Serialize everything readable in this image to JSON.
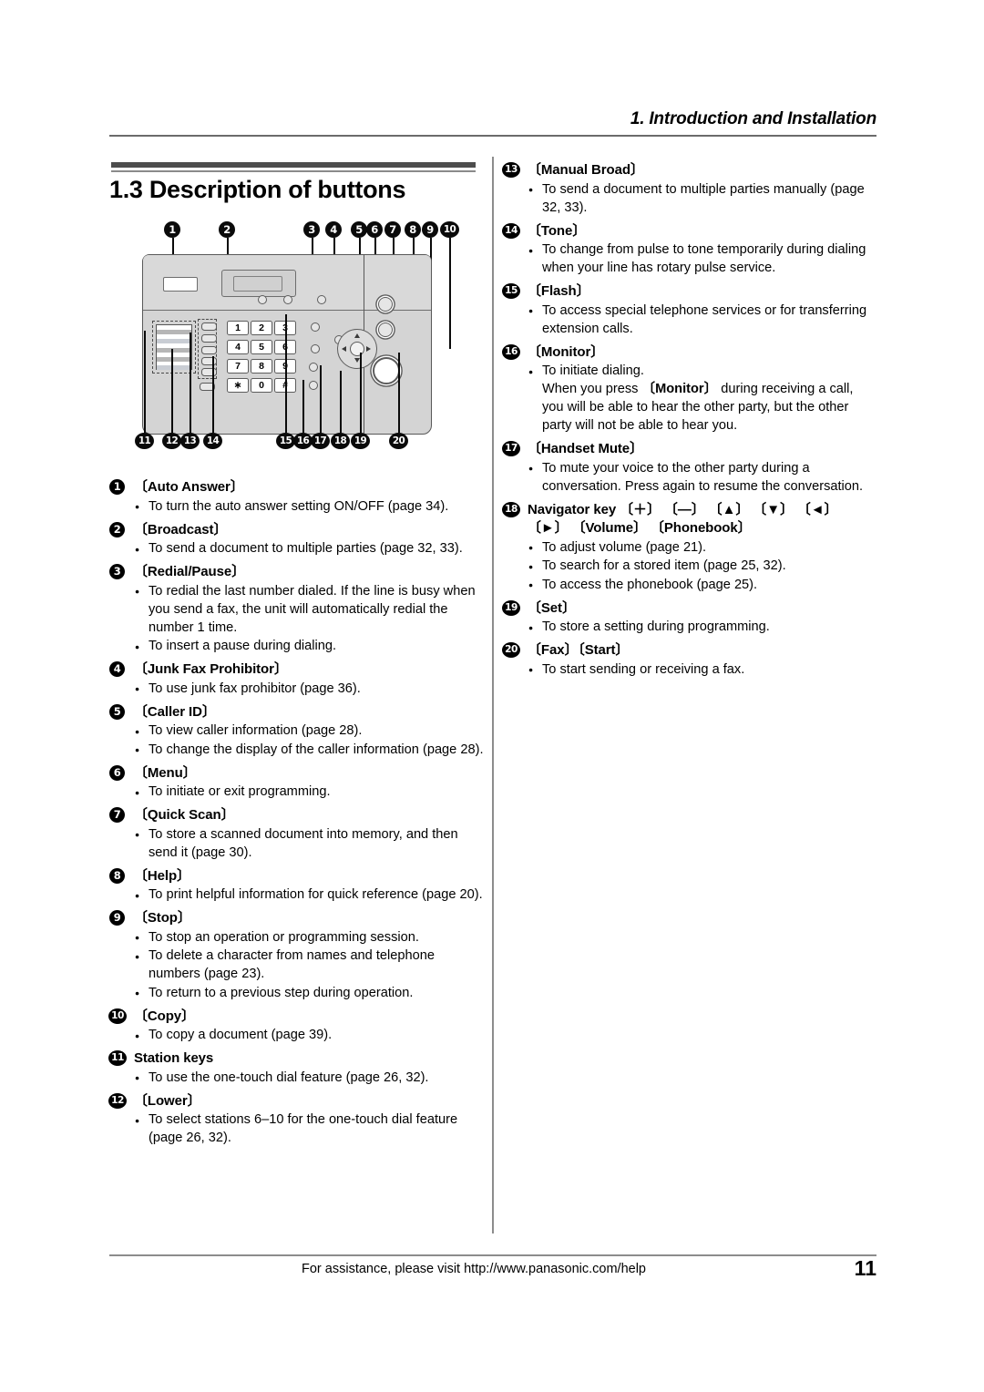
{
  "running_head": "1. Introduction and Installation",
  "section_title": "1.3 Description of buttons",
  "diagram": {
    "name": "fax-machine-control-panel-diagram",
    "top_callouts": [
      "1",
      "2",
      "3",
      "4",
      "5",
      "6",
      "7",
      "8",
      "9",
      "10"
    ],
    "bottom_callouts": [
      "11",
      "12",
      "13",
      "14",
      "15",
      "16",
      "17",
      "18",
      "19",
      "20"
    ],
    "keypad_keys": [
      "1",
      "2",
      "3",
      "4",
      "5",
      "6",
      "7",
      "8",
      "9",
      "∗",
      "0",
      "#"
    ]
  },
  "left_column": [
    {
      "num": "1",
      "label": "〔Auto Answer〕",
      "bullets": [
        {
          "text": "To turn the auto answer setting ON/OFF (page 34)."
        }
      ]
    },
    {
      "num": "2",
      "label": "〔Broadcast〕",
      "bullets": [
        {
          "text": "To send a document to multiple parties (page 32, 33)."
        }
      ]
    },
    {
      "num": "3",
      "label": "〔Redial/Pause〕",
      "bullets": [
        {
          "text": "To redial the last number dialed. If the line is busy when you send a fax, the unit will automatically redial the number 1 time."
        },
        {
          "text": "To insert a pause during dialing."
        }
      ]
    },
    {
      "num": "4",
      "label": "〔Junk Fax Prohibitor〕",
      "bullets": [
        {
          "text": "To use junk fax prohibitor (page 36)."
        }
      ]
    },
    {
      "num": "5",
      "label": "〔Caller ID〕",
      "bullets": [
        {
          "text": "To view caller information (page 28)."
        },
        {
          "text": "To change the display of the caller information (page 28)."
        }
      ]
    },
    {
      "num": "6",
      "label": "〔Menu〕",
      "bullets": [
        {
          "text": "To initiate or exit programming."
        }
      ]
    },
    {
      "num": "7",
      "label": "〔Quick Scan〕",
      "bullets": [
        {
          "text": "To store a scanned document into memory, and then send it (page 30)."
        }
      ]
    },
    {
      "num": "8",
      "label": "〔Help〕",
      "bullets": [
        {
          "text": "To print helpful information for quick reference (page 20)."
        }
      ]
    },
    {
      "num": "9",
      "label": "〔Stop〕",
      "bullets": [
        {
          "text": "To stop an operation or programming session."
        },
        {
          "text": "To delete a character from names and telephone numbers (page 23)."
        },
        {
          "text": "To return to a previous step during operation."
        }
      ]
    },
    {
      "num": "10",
      "label": "〔Copy〕",
      "bullets": [
        {
          "text": "To copy a document (page 39)."
        }
      ]
    },
    {
      "num": "11",
      "label": "Station keys",
      "bullets": [
        {
          "text": "To use the one-touch dial feature (page 26, 32)."
        }
      ]
    },
    {
      "num": "12",
      "label": "〔Lower〕",
      "bullets": [
        {
          "text": "To select stations 6–10 for the one-touch dial feature (page 26, 32)."
        }
      ]
    }
  ],
  "right_column": [
    {
      "num": "13",
      "label": "〔Manual Broad〕",
      "bullets": [
        {
          "text": "To send a document to multiple parties manually (page 32, 33)."
        }
      ]
    },
    {
      "num": "14",
      "label": "〔Tone〕",
      "bullets": [
        {
          "text": "To change from pulse to tone temporarily during dialing when your line has rotary pulse service."
        }
      ]
    },
    {
      "num": "15",
      "label": "〔Flash〕",
      "bullets": [
        {
          "text": "To access special telephone services or for transferring extension calls."
        }
      ]
    },
    {
      "num": "16",
      "label": "〔Monitor〕",
      "bullets": [
        {
          "text": "To initiate dialing.",
          "sub_before": "When you press ",
          "sub_bold": "〔Monitor〕",
          "sub_after": " during receiving a call, you will be able to hear the other party, but the other party will not be able to hear you."
        }
      ]
    },
    {
      "num": "17",
      "label": "〔Handset Mute〕",
      "bullets": [
        {
          "text": "To mute your voice to the other party during a conversation. Press again to resume the conversation."
        }
      ]
    },
    {
      "num": "18",
      "label": "Navigator key 〔＋〕 〔—〕 〔▲〕 〔▼〕 〔◄〕 〔►〕 〔Volume〕 〔Phonebook〕",
      "bullets": [
        {
          "text": "To adjust volume (page 21)."
        },
        {
          "text": "To search for a stored item (page 25, 32)."
        },
        {
          "text": "To access the phonebook (page 25)."
        }
      ]
    },
    {
      "num": "19",
      "label": "〔Set〕",
      "bullets": [
        {
          "text": "To store a setting during programming."
        }
      ]
    },
    {
      "num": "20",
      "label": "〔Fax〕〔Start〕",
      "bullets": [
        {
          "text": "To start sending or receiving a fax."
        }
      ]
    }
  ],
  "footer": {
    "assistance": "For assistance, please visit http://www.panasonic.com/help",
    "page_number": "11"
  }
}
